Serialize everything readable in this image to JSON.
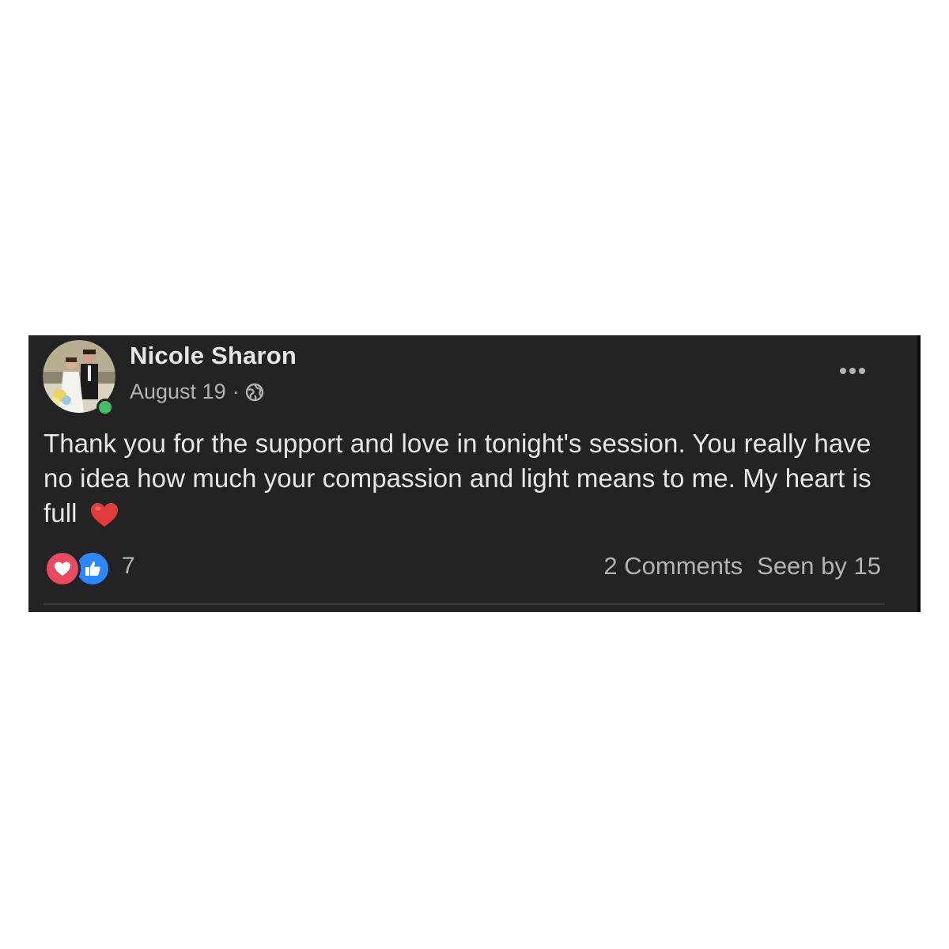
{
  "post": {
    "author": "Nicole Sharon",
    "date": "August 19",
    "separator": "·",
    "privacy_icon": "globe-icon",
    "more_icon": "more-options-icon",
    "text": "Thank you for the support and love in tonight's session. You really have no idea how much your compassion and light means to me. My heart is full",
    "text_emoji": "heart-emoji",
    "online": true,
    "reactions": {
      "icons": [
        "love-icon",
        "like-icon"
      ],
      "count": "7"
    },
    "comments": "2 Comments",
    "seen_by": "Seen by 15"
  },
  "colors": {
    "background": "#232325",
    "primary_text": "#e4e6eb",
    "secondary_text": "#b0b3b8",
    "online": "#45bd62",
    "love": "#e84b5f",
    "like": "#2d88ff"
  }
}
